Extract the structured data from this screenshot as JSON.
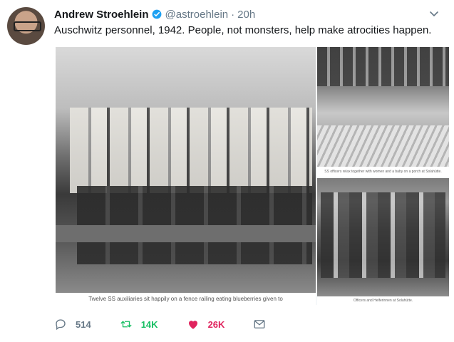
{
  "tweet": {
    "author_name": "Andrew Stroehlein",
    "handle": "@astroehlein",
    "separator": "·",
    "time": "20h",
    "text": "Auschwitz personnel, 1942. People, not monsters, help make atrocities happen.",
    "verified_icon": "verified-badge-icon",
    "menu_icon": "chevron-down-icon"
  },
  "media": {
    "caption_main": "Twelve SS auxiliaries sit happily on a fence railing eating blueberries given to",
    "caption_top_right": "SS officers relax together with women and a baby on a porch at Solahütte.",
    "caption_bottom_right": "Officers and Helferinnen at Solahütte."
  },
  "actions": {
    "reply_count": "514",
    "retweet_count": "14K",
    "like_count": "26K"
  },
  "colors": {
    "text": "#14171a",
    "muted": "#657786",
    "verified": "#1da1f2",
    "retweet": "#17bf63",
    "like": "#e0245e"
  }
}
